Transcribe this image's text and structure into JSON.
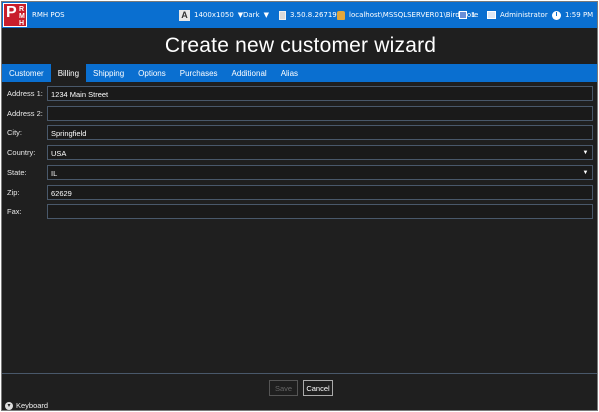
{
  "topbar": {
    "logo_letters": {
      "big": "P",
      "r": "R",
      "m": "M",
      "h": "H"
    },
    "app_name": "RMH POS",
    "resolution": "1400x1050",
    "theme": "Dark",
    "version": "3.50.8.26719",
    "connection": "localhost\\MSSQLSERVER01\\BirdStore",
    "station": "1",
    "user": "Administrator",
    "time": "1:59 PM",
    "accent": "#0a6fd0"
  },
  "title": "Create new customer wizard",
  "tabs": [
    {
      "label": "Customer",
      "active": false
    },
    {
      "label": "Billing",
      "active": true
    },
    {
      "label": "Shipping",
      "active": false
    },
    {
      "label": "Options",
      "active": false
    },
    {
      "label": "Purchases",
      "active": false
    },
    {
      "label": "Additional",
      "active": false
    },
    {
      "label": "Alias",
      "active": false
    }
  ],
  "form": {
    "address1": {
      "label": "Address 1:",
      "value": "1234 Main Street"
    },
    "address2": {
      "label": "Address 2:",
      "value": ""
    },
    "city": {
      "label": "City:",
      "value": "Springfield"
    },
    "country": {
      "label": "Country:",
      "value": "USA"
    },
    "state": {
      "label": "State:",
      "value": "IL"
    },
    "zip": {
      "label": "Zip:",
      "value": "62629"
    },
    "fax": {
      "label": "Fax:",
      "value": ""
    }
  },
  "buttons": {
    "save": "Save",
    "cancel": "Cancel"
  },
  "keyboard": {
    "label": "Keyboard"
  }
}
